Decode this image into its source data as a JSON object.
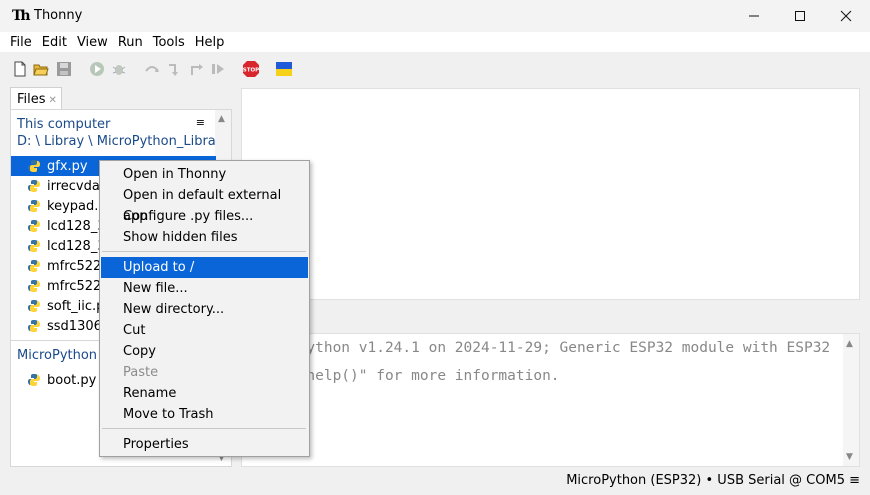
{
  "window": {
    "title": "Thonny"
  },
  "menu": [
    "File",
    "Edit",
    "View",
    "Run",
    "Tools",
    "Help"
  ],
  "files_tab": {
    "label": "Files"
  },
  "this_computer": {
    "title": "This computer",
    "path": "D: \\ Libray \\ MicroPython_Libray",
    "files": [
      "gfx.py",
      "irrecvdata.py",
      "keypad.py",
      "lcd128_32.py",
      "lcd128_32_fonts.py",
      "mfrc522_config.py",
      "mfrc522_i2c.py",
      "soft_iic.py",
      "ssd1306.py"
    ]
  },
  "micropython_device": {
    "title": "MicroPython device",
    "files": [
      "boot.py"
    ]
  },
  "shell": {
    "lines": [
      "MicroPython v1.24.1 on 2024-11-29; Generic ESP32 module with ESP32",
      "Type \"help()\" for more information."
    ]
  },
  "status": {
    "text": "MicroPython (ESP32)  •  USB Serial @ COM5  ≡"
  },
  "context_menu": {
    "items": [
      {
        "label": "Open in Thonny",
        "state": "normal"
      },
      {
        "label": "Open in default external app",
        "state": "normal"
      },
      {
        "label": "Configure .py files...",
        "state": "normal"
      },
      {
        "label": "Show hidden files",
        "state": "normal"
      },
      {
        "label": "Upload to /",
        "state": "highlighted"
      },
      {
        "label": "New file...",
        "state": "normal"
      },
      {
        "label": "New directory...",
        "state": "normal"
      },
      {
        "label": "Cut",
        "state": "normal"
      },
      {
        "label": "Copy",
        "state": "normal"
      },
      {
        "label": "Paste",
        "state": "disabled"
      },
      {
        "label": "Rename",
        "state": "normal"
      },
      {
        "label": "Move to Trash",
        "state": "normal"
      },
      {
        "label": "Properties",
        "state": "normal"
      }
    ]
  },
  "icons": {
    "toolbar": [
      "new-file-icon",
      "open-folder-icon",
      "save-icon",
      "run-icon",
      "debug-icon",
      "step-over-icon",
      "step-into-icon",
      "step-out-icon",
      "resume-icon",
      "stop-icon",
      "ukraine-flag-icon"
    ]
  },
  "colors": {
    "selection": "#0a66d8",
    "link": "#1a4a8a",
    "stop": "#d9262c"
  }
}
